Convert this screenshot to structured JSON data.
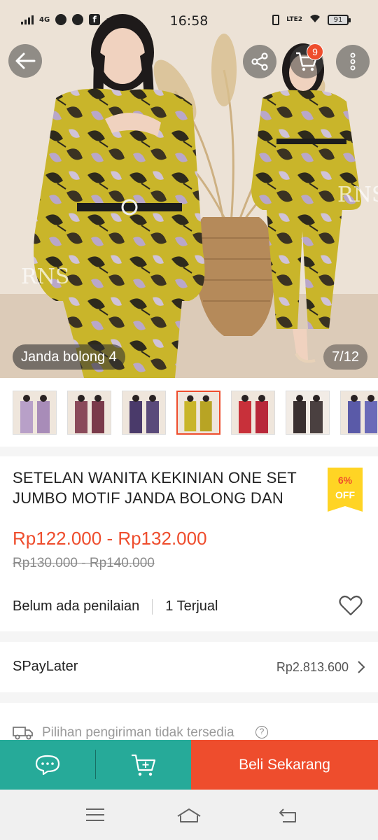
{
  "status_bar": {
    "time": "16:58",
    "network_left": "4G",
    "network_right": "LTE2",
    "battery": "91",
    "more": "···"
  },
  "gallery": {
    "variant_label": "Janda bolong 4",
    "counter": "7/12",
    "cart_count": "9",
    "watermark": "RNS"
  },
  "product": {
    "title": "SETELAN WANITA KEKINIAN ONE SET JUMBO MOTIF JANDA BOLONG DAN",
    "discount_percent": "6%",
    "discount_off": "OFF",
    "price_range": "Rp122.000 - Rp132.000",
    "original_price_range": "Rp130.000 - Rp140.000",
    "rating_text": "Belum ada penilaian",
    "sold_text": "1 Terjual"
  },
  "spaylater": {
    "label": "SPayLater",
    "value": "Rp2.813.600"
  },
  "shipping": {
    "text": "Pilihan pengiriman tidak tersedia"
  },
  "actions": {
    "buy_now": "Beli Sekarang"
  },
  "colors": {
    "brand": "#ee4d2d",
    "teal": "#26aa99",
    "badge_yellow": "#ffd424"
  }
}
